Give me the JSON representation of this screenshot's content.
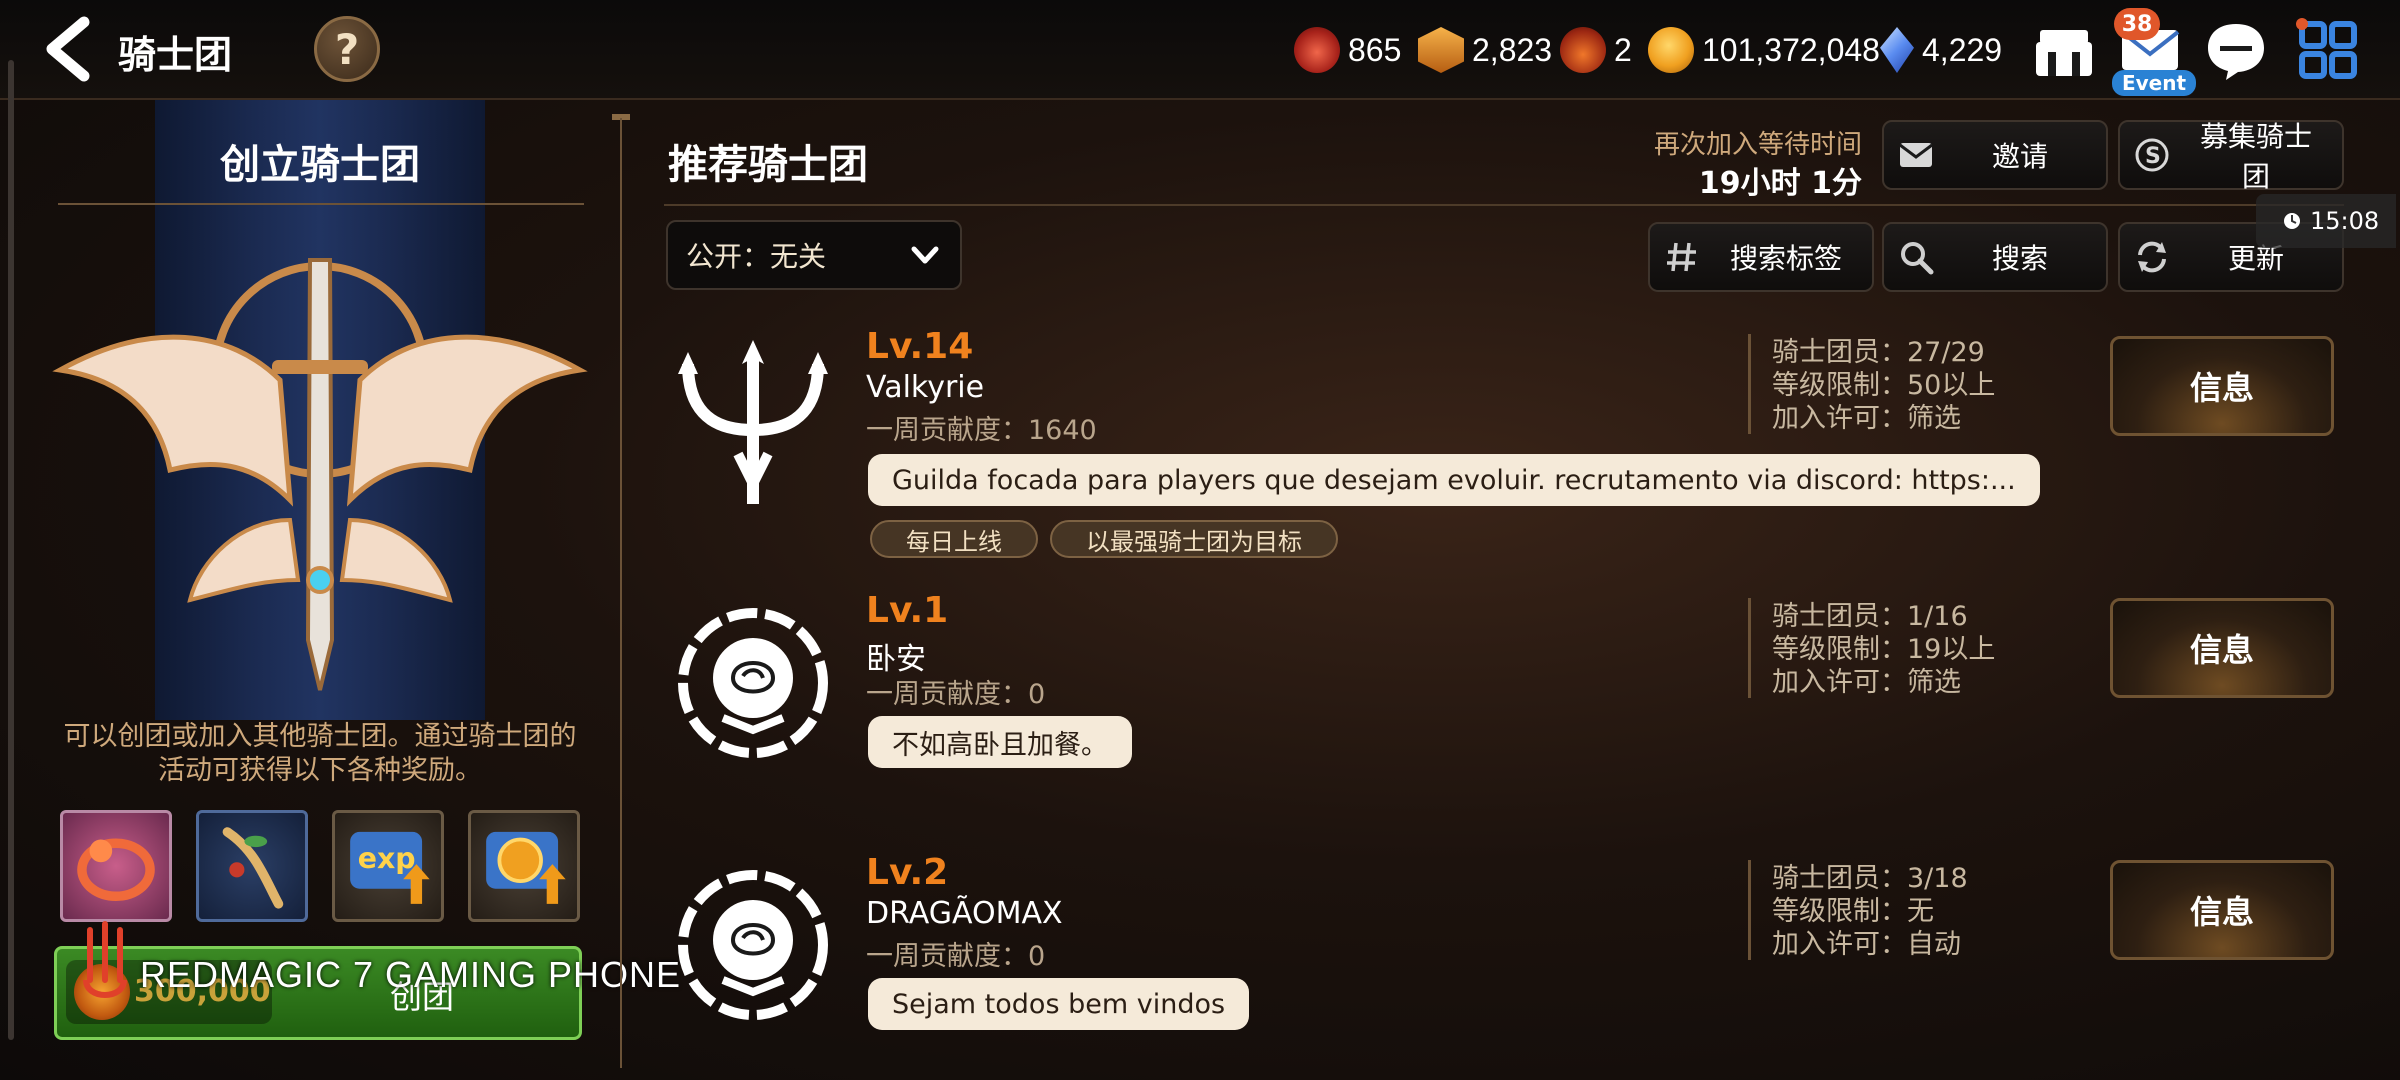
{
  "header": {
    "title": "骑士团",
    "help": "?",
    "resources": [
      {
        "icon": "ring-icon",
        "value": "865",
        "color": "#c0392b"
      },
      {
        "icon": "chest-icon",
        "value": "2,823",
        "color": "#e0932a"
      },
      {
        "icon": "fire-crystal-icon",
        "value": "2",
        "color": "#d04420"
      },
      {
        "icon": "gold-icon",
        "value": "101,372,048",
        "color": "#f0a020"
      },
      {
        "icon": "crystal-icon",
        "value": "4,229",
        "color": "#5a8cf0"
      }
    ],
    "mail_badge": "38",
    "event_label": "Event"
  },
  "left": {
    "title": "创立骑士团",
    "description": "可以创团或加入其他骑士团。通过骑士团的活动可获得以下各种奖励。",
    "rewards": [
      "reward-ring-icon",
      "reward-herb-icon",
      "reward-exp-icon",
      "reward-gold-boost-icon"
    ],
    "create_cost": "300,000",
    "create_label": "创团",
    "watermark": "REDMAGIC 7 GAMING PHONE"
  },
  "right": {
    "title": "推荐骑士团",
    "rejoin_label": "再次加入等待时间",
    "rejoin_value": "19小时 1分",
    "invite_label": "邀请",
    "recruit_label": "募集骑士团",
    "filter_label": "公开：无关",
    "search_tag_label": "搜索标签",
    "search_label": "搜索",
    "refresh_label": "更新",
    "clock": "15:08",
    "guilds": [
      {
        "level": "Lv.14",
        "name": "Valkyrie",
        "contribution": "一周贡献度：1640",
        "description": "Guilda focada para players que desejam evoluir. recrutamento via discord: https:...",
        "tags": [
          "每日上线",
          "以最强骑士团为目标"
        ],
        "members": "骑士团员：27/29",
        "level_limit": "等级限制：50以上",
        "join": "加入许可：筛选",
        "info_label": "信息"
      },
      {
        "level": "Lv.1",
        "name": "卧安",
        "contribution": "一周贡献度：0",
        "description": "不如高卧且加餐。",
        "tags": [],
        "members": "骑士团员：1/16",
        "level_limit": "等级限制：19以上",
        "join": "加入许可：筛选",
        "info_label": "信息"
      },
      {
        "level": "Lv.2",
        "name": "DRAGÃOMAX",
        "contribution": "一周贡献度：0",
        "description": "Sejam todos bem vindos",
        "tags": [],
        "members": "骑士团员：3/18",
        "level_limit": "等级限制：无",
        "join": "加入许可：自动",
        "info_label": "信息"
      }
    ]
  }
}
